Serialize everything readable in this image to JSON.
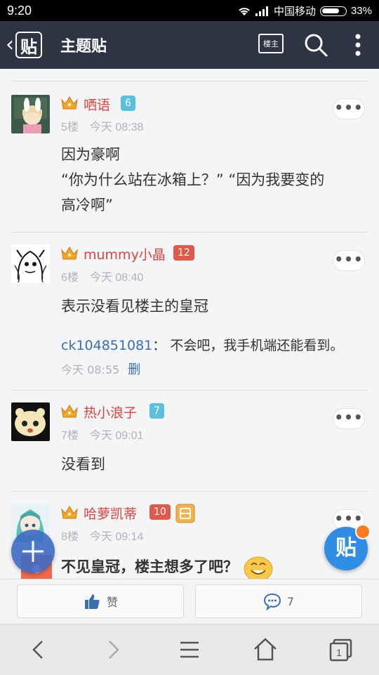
{
  "status_bar": {
    "time": "9:20",
    "carrier": "中国移动",
    "battery": "33%"
  },
  "header": {
    "title": "主题贴",
    "back_logo": "贴",
    "louzhu_label": "楼主"
  },
  "posts": [
    {
      "name": "哂语",
      "level": "6",
      "floor": "5楼",
      "time": "今天 08:38",
      "content": [
        "因为豪啊",
        "“你为什么站在冰箱上？” “因为我要变的",
        "高冷啊”"
      ]
    },
    {
      "name": "mummy小晶",
      "level": "12",
      "floor": "6楼",
      "time": "今天 08:40",
      "content": [
        "表示没看见楼主的皇冠"
      ],
      "comment": {
        "user": "ck104851081",
        "sep": "：",
        "text": "不会吧，我手机端还能看到。",
        "time": "今天 08:55",
        "delete": "删"
      }
    },
    {
      "name": "热小浪子",
      "level": "7",
      "floor": "7楼",
      "time": "今天 09:01",
      "content": [
        "没看到"
      ]
    },
    {
      "name": "哈萝凯蒂",
      "level": "10",
      "floor": "8楼",
      "time": "今天 09:14",
      "content": [
        "不见皇冠，楼主想多了吧？"
      ]
    }
  ],
  "actions": {
    "like_label": "赞",
    "comment_count": "7"
  },
  "fab": {
    "post_label": "贴"
  },
  "colors": {
    "titlebar": "#2f3444",
    "username": "#e0413a",
    "link": "#3a6fb3",
    "accent": "#2f8de4"
  }
}
